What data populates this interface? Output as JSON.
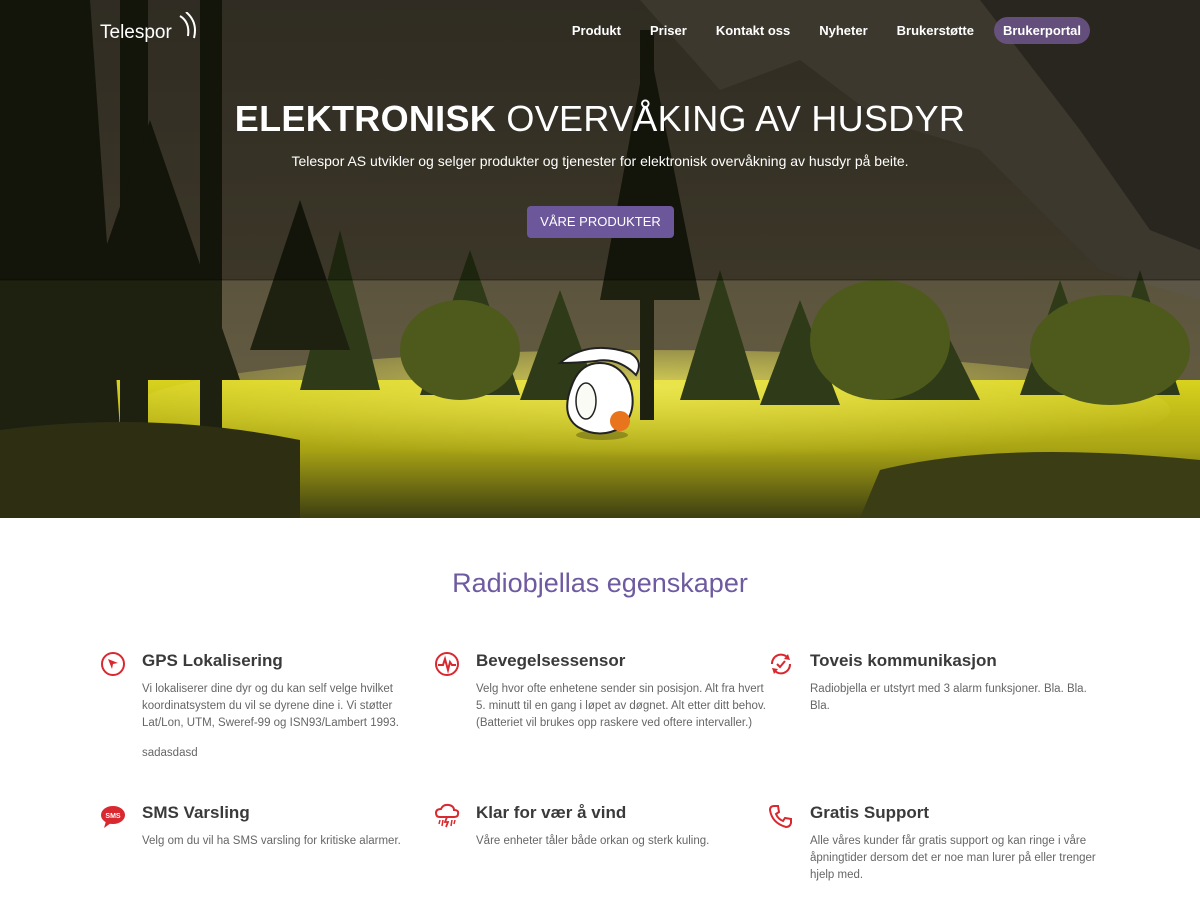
{
  "header": {
    "logo_text": "Telespor",
    "nav": [
      {
        "label": "Produkt"
      },
      {
        "label": "Priser"
      },
      {
        "label": "Kontakt oss"
      },
      {
        "label": "Nyheter"
      },
      {
        "label": "Brukerstøtte"
      },
      {
        "label": "Brukerportal",
        "active": true
      }
    ]
  },
  "hero": {
    "title_bold": "ELEKTRONISK",
    "title_light": "OVERVÅKING AV HUSDYR",
    "subtitle": "Telespor AS utvikler og selger produkter og tjenester for elektronisk overvåkning av husdyr på beite.",
    "cta_label": "VÅRE PRODUKTER"
  },
  "features": {
    "title": "Radiobjellas egenskaper",
    "items": [
      {
        "icon": "compass-icon",
        "title": "GPS Lokalisering",
        "text": "Vi lokaliserer dine dyr og du kan self velge hvilket koordinatsystem du vil se dyrene dine i. Vi støtter Lat/Lon, UTM, Sweref-99 og ISN93/Lambert 1993.",
        "extra": "sadasdasd"
      },
      {
        "icon": "pulse-icon",
        "title": "Bevegelsessensor",
        "text": "Velg hvor ofte enhetene sender sin posisjon. Alt fra hvert 5. minutt til en gang i løpet av døgnet. Alt etter ditt behov. (Batteriet vil brukes opp raskere ved oftere intervaller.)"
      },
      {
        "icon": "sync-check-icon",
        "title": "Toveis kommunikasjon",
        "text": "Radiobjella er utstyrt med 3 alarm funksjoner. Bla. Bla. Bla."
      },
      {
        "icon": "sms-icon",
        "title": "SMS Varsling",
        "text": "Velg om du vil ha SMS varsling for kritiske alarmer."
      },
      {
        "icon": "storm-cloud-icon",
        "title": "Klar for vær å vind",
        "text": "Våre enheter tåler både orkan og sterk kuling."
      },
      {
        "icon": "phone-icon",
        "title": "Gratis Support",
        "text": "Alle våres kunder får gratis support og kan ringe i våre åpningtider dersom det er noe man lurer på eller trenger hjelp med."
      }
    ]
  },
  "colors": {
    "accent": "#6e5aa0",
    "icon_red": "#d9282f",
    "button": "#6b579a"
  }
}
